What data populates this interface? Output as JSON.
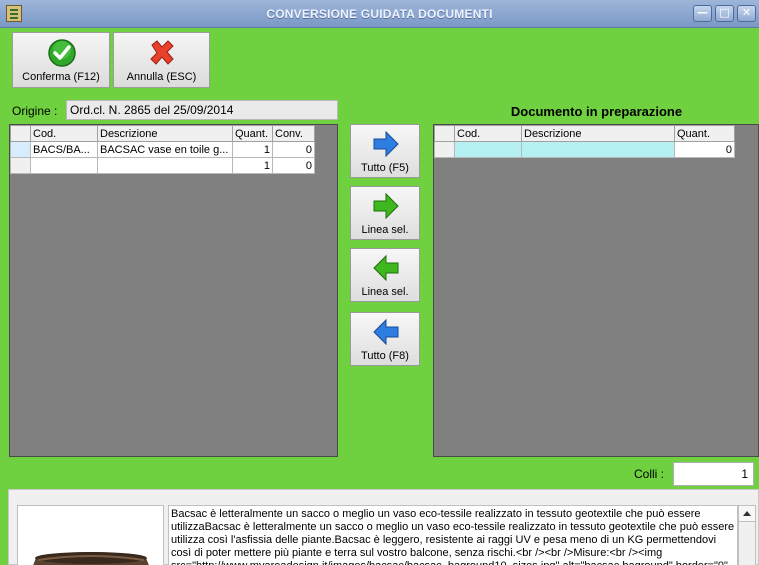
{
  "window": {
    "title": "CONVERSIONE GUIDATA DOCUMENTI",
    "minimize": "—",
    "maximize": "□",
    "close": "✕"
  },
  "toolbar": {
    "confirm_label": "Conferma (F12)",
    "cancel_label": "Annulla (ESC)"
  },
  "origin": {
    "label": "Origine :",
    "value": "Ord.cl. N. 2865 del 25/09/2014"
  },
  "left_grid": {
    "headers": [
      "Cod.",
      "Descrizione",
      "Quant.",
      "Conv."
    ],
    "rows": [
      {
        "cod": "BACS/BA...",
        "descrizione": "BACSAC vase en toile g...",
        "quant": "1",
        "conv": "0"
      },
      {
        "cod": "",
        "descrizione": "",
        "quant": "1",
        "conv": "0"
      }
    ]
  },
  "transfer_buttons": {
    "all_right": "Tutto (F5)",
    "line_right": "Linea sel.",
    "line_left": "Linea sel.",
    "all_left": "Tutto (F8)"
  },
  "right_panel": {
    "title": "Documento in preparazione",
    "headers": [
      "Cod.",
      "Descrizione",
      "Quant."
    ],
    "rows": [
      {
        "cod": "",
        "descrizione": "",
        "quant": "0"
      }
    ]
  },
  "colli": {
    "label": "Colli :",
    "value": "1"
  },
  "description_text": "Bacsac è letteralmente un sacco o meglio un vaso eco-tessile realizzato in tessuto geotextile che può essere utilizzaBacsac è letteralmente un sacco o meglio un vaso eco-tessile realizzato in tessuto geotextile che può essere utilizza così l'asfissia delle piante.Bacsac è leggero, resistente ai raggi UV e pesa meno di un KG permettendovi così di poter mettere più piante e terra sul vostro balcone, senza rischi.<br /><br />Misure:<br /><img src=\"http://www.myareadesign.it/images/bacsac/bacsac_baground10_sizes.jpg\" alt=\"bacsac baground\" border=\"0\"",
  "colors": {
    "background": "#6fd13f",
    "grid_bg": "#808080",
    "selected_cell": "#b5f1f3",
    "arrow_blue": "#2e7de0",
    "arrow_green": "#3fb81f"
  }
}
